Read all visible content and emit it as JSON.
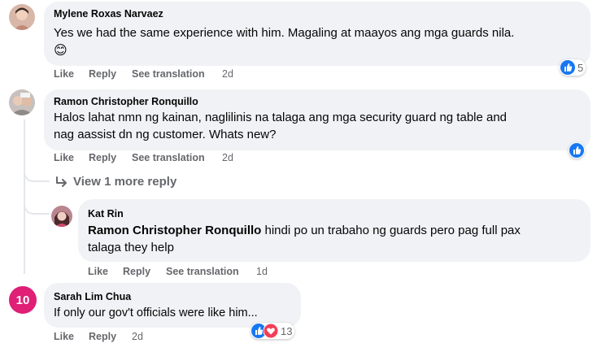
{
  "comments": [
    {
      "author": "Mylene Roxas Narvaez",
      "text": "Yes we had the same experience with him. Magaling at maayos ang mga guards nila.",
      "emoji": "😊",
      "like": "Like",
      "reply": "Reply",
      "see_translation": "See translation",
      "time": "2d",
      "reaction_count": "5"
    },
    {
      "author": "Ramon Christopher Ronquillo",
      "text_line1": "Halos lahat nmn ng kainan, naglilinis na talaga ang mga security guard ng table and",
      "text_line2": "nag aassist dn ng customer. Whats new?",
      "like": "Like",
      "reply": "Reply",
      "see_translation": "See translation",
      "time": "2d"
    },
    {
      "author": "Kat Rin",
      "mention": "Ramon Christopher Ronquillo",
      "text_line1": " hindi po un trabaho ng guards pero pag full pax",
      "text_line2": "talaga they help",
      "like": "Like",
      "reply": "Reply",
      "see_translation": "See translation",
      "time": "1d"
    },
    {
      "author": "Sarah Lim Chua",
      "avatar_badge": "10",
      "text": "If only our gov't officials were like him...",
      "like": "Like",
      "reply": "Reply",
      "time": "2d",
      "reaction_count": "13"
    }
  ],
  "view_more_replies": "View 1 more reply",
  "colors": {
    "bubble": "#f0f2f5",
    "like_blue": "#1877f2",
    "love_red": "#f33e58",
    "meta_gray": "#65676b",
    "badge_pink": "#e01f77"
  }
}
